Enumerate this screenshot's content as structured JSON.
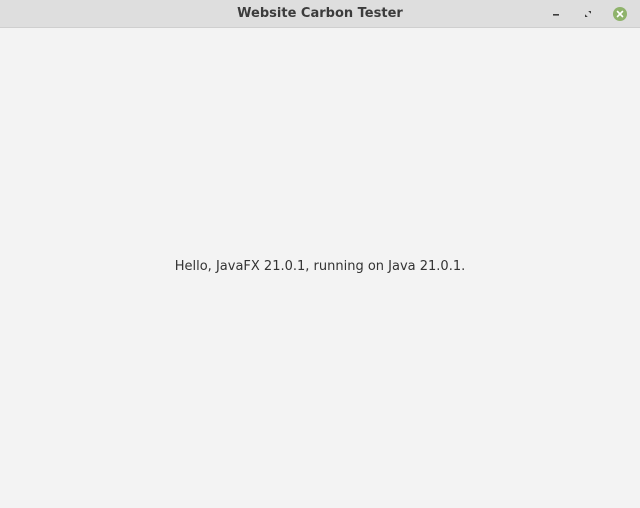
{
  "window": {
    "title": "Website Carbon Tester",
    "controls": {
      "minimize_icon": "minimize-icon",
      "maximize_icon": "maximize-icon",
      "close_icon": "close-icon",
      "close_color": "#8fb36b"
    }
  },
  "content": {
    "message": "Hello, JavaFX 21.0.1, running on Java 21.0.1."
  }
}
